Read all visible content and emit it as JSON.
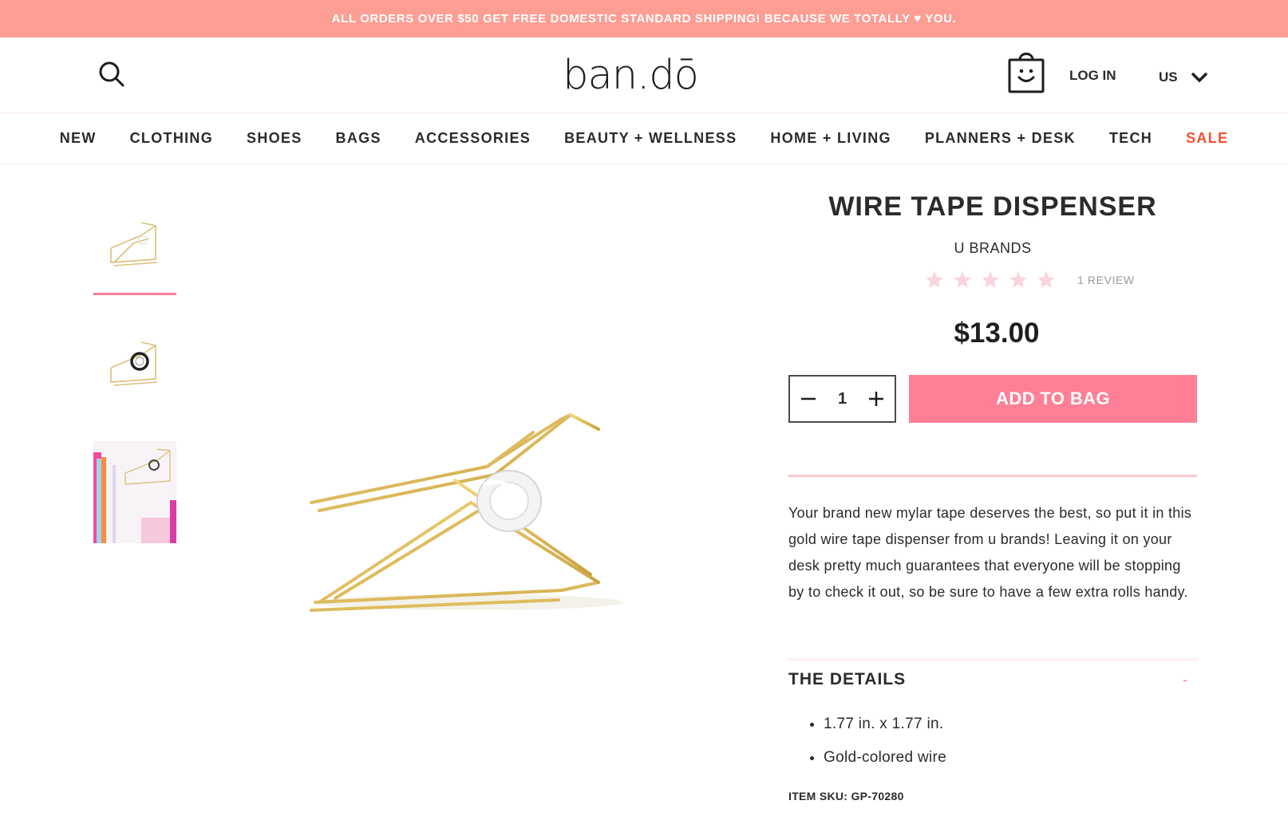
{
  "promo": {
    "text": "ALL ORDERS OVER $50 GET FREE DOMESTIC STANDARD SHIPPING! BECAUSE WE TOTALLY ♥ YOU."
  },
  "header": {
    "logo": "ban.dō",
    "search_icon": "search-icon",
    "bag_icon": "shopping-bag-smiley-icon",
    "login": "LOG IN",
    "country": "US",
    "country_icon": "chevron-down-icon"
  },
  "nav": {
    "items": [
      {
        "label": "NEW"
      },
      {
        "label": "CLOTHING"
      },
      {
        "label": "SHOES"
      },
      {
        "label": "BAGS"
      },
      {
        "label": "ACCESSORIES"
      },
      {
        "label": "BEAUTY + WELLNESS"
      },
      {
        "label": "HOME + LIVING"
      },
      {
        "label": "PLANNERS + DESK"
      },
      {
        "label": "TECH"
      },
      {
        "label": "SALE"
      }
    ],
    "sale_color": "#f0502f"
  },
  "gallery": {
    "thumbnails": [
      "tape-dispenser-empty",
      "tape-dispenser-with-tape",
      "tape-dispenser-lifestyle"
    ],
    "selected_index": 0
  },
  "product": {
    "title": "WIRE TAPE DISPENSER",
    "brand": "U BRANDS",
    "rating_stars": 5,
    "reviews": "1 REVIEW",
    "price": "$13.00",
    "quantity": "1",
    "add_to_bag": "ADD TO BAG",
    "description": "Your brand new mylar tape deserves the best, so put it in this gold wire tape dispenser from u brands! Leaving it on your desk pretty much guarantees that everyone will be stopping by to check it out, so be sure to have a few extra rolls handy.",
    "details": {
      "title": "THE DETAILS",
      "toggle": "-",
      "items": [
        "1.77 in. x 1.77 in.",
        "Gold-colored wire"
      ]
    },
    "sku": "ITEM SKU: GP-70280"
  },
  "colors": {
    "promo_bg": "#fc9e94",
    "accent_pink": "#ff8096",
    "star_pink": "#fbd3da",
    "gold": "#d9b45a"
  }
}
